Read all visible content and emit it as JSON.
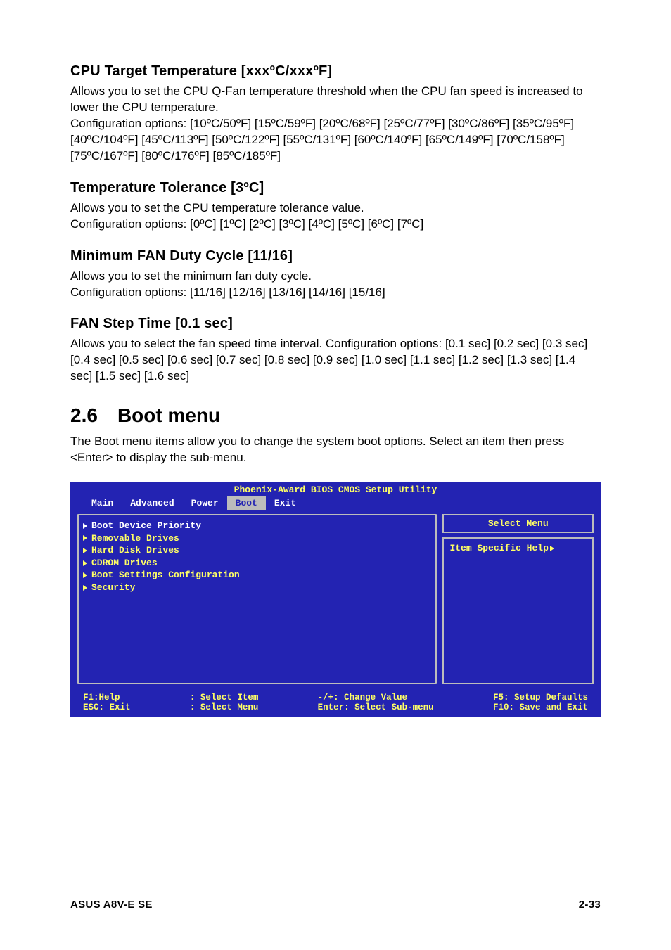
{
  "sections": {
    "cpu_target": {
      "heading": "CPU Target Temperature [xxxºC/xxxºF]",
      "body": "Allows you to set the CPU Q-Fan temperature threshold when the CPU fan speed is increased to lower the CPU temperature.\nConfiguration options: [10ºC/50ºF] [15ºC/59ºF] [20ºC/68ºF] [25ºC/77ºF] [30ºC/86ºF] [35ºC/95ºF] [40ºC/104ºF] [45ºC/113ºF] [50ºC/122ºF] [55ºC/131ºF] [60ºC/140ºF] [65ºC/149ºF] [70ºC/158ºF] [75ºC/167ºF] [80ºC/176ºF] [85ºC/185ºF]"
    },
    "temp_tolerance": {
      "heading": "Temperature Tolerance [3ºC]",
      "body": "Allows you to set the CPU temperature tolerance value.\nConfiguration options: [0ºC] [1ºC] [2ºC] [3ºC] [4ºC] [5ºC] [6ºC] [7ºC]"
    },
    "min_fan": {
      "heading": "Minimum FAN Duty Cycle [11/16]",
      "body": "Allows you to set the minimum fan duty cycle.\nConfiguration options: [11/16] [12/16] [13/16] [14/16] [15/16]"
    },
    "fan_step": {
      "heading": "FAN Step Time [0.1 sec]",
      "body": "Allows you to select the fan speed time interval. Configuration options: [0.1 sec] [0.2 sec] [0.3 sec] [0.4 sec] [0.5 sec] [0.6 sec] [0.7 sec] [0.8 sec] [0.9 sec] [1.0 sec] [1.1 sec] [1.2 sec] [1.3 sec] [1.4 sec] [1.5 sec] [1.6 sec]"
    }
  },
  "chapter": {
    "number": "2.6",
    "title": "Boot menu",
    "intro": "The Boot menu items allow you to change the system boot options. Select an item then press <Enter> to display the sub-menu."
  },
  "bios": {
    "title": "Phoenix-Award BIOS CMOS Setup Utility",
    "tabs": [
      "Main",
      "Advanced",
      "Power",
      "Boot",
      "Exit"
    ],
    "active_tab": "Boot",
    "items": [
      {
        "label": "Boot Device Priority",
        "highlight": true
      },
      {
        "label": "Removable Drives",
        "highlight": false
      },
      {
        "label": "Hard Disk Drives",
        "highlight": false
      },
      {
        "label": "CDROM Drives",
        "highlight": false
      },
      {
        "label": "Boot Settings Configuration",
        "highlight": false
      },
      {
        "label": "Security",
        "highlight": false
      }
    ],
    "right_top": "Select Menu",
    "right_bottom": "Item Specific Help",
    "footer": {
      "col1a": "F1:Help",
      "col1b": "ESC: Exit",
      "col2a": ": Select Item",
      "col2b": ": Select Menu",
      "col3a": "-/+: Change Value",
      "col3b": "Enter: Select Sub-menu",
      "col4a": "F5: Setup Defaults",
      "col4b": "F10: Save and Exit"
    }
  },
  "footer": {
    "left": "ASUS A8V-E SE",
    "right": "2-33"
  }
}
